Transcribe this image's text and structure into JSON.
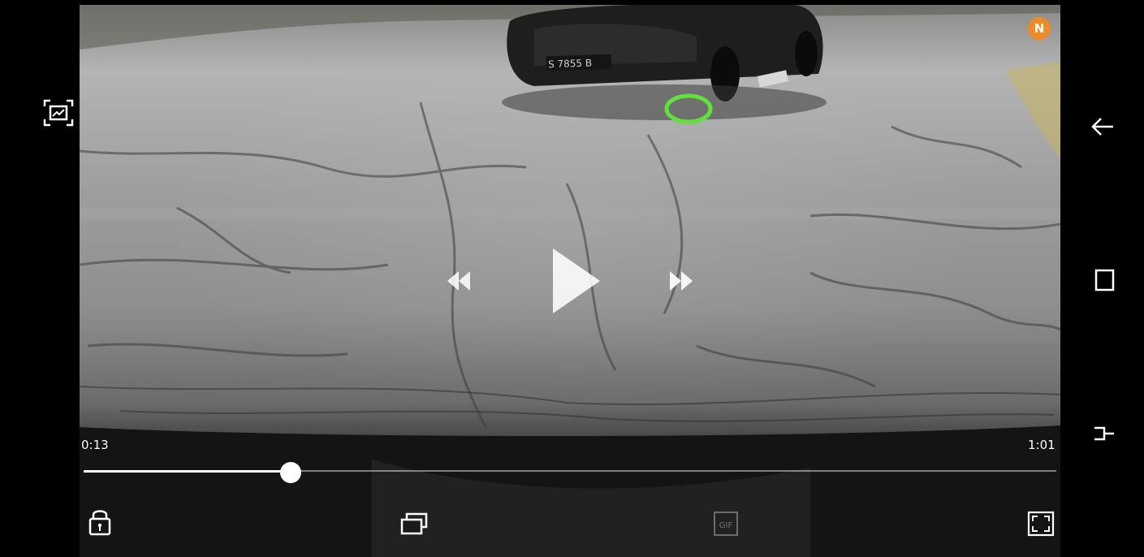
{
  "player": {
    "current_time": "0:13",
    "total_time": "1:01",
    "progress_fraction": 0.213
  },
  "video": {
    "plate_text": "S 7855 B"
  },
  "user": {
    "avatar_initial": "N",
    "avatar_color": "#f08a24"
  },
  "controls": {
    "gif_label": "GIF"
  },
  "icons": {
    "screenshot": "gallery-capture-icon",
    "back": "back-arrow-icon",
    "recents": "recent-apps-icon",
    "overview": "overview-icon",
    "rewind": "rewind-icon",
    "play": "play-icon",
    "fast_forward": "fast-forward-icon",
    "lock": "lock-icon",
    "pop_up": "popup-window-icon",
    "gif": "gif-icon",
    "fullscreen": "fullscreen-icon"
  },
  "colors": {
    "annotation": "#5fe23a",
    "controls": "#ffffff"
  }
}
